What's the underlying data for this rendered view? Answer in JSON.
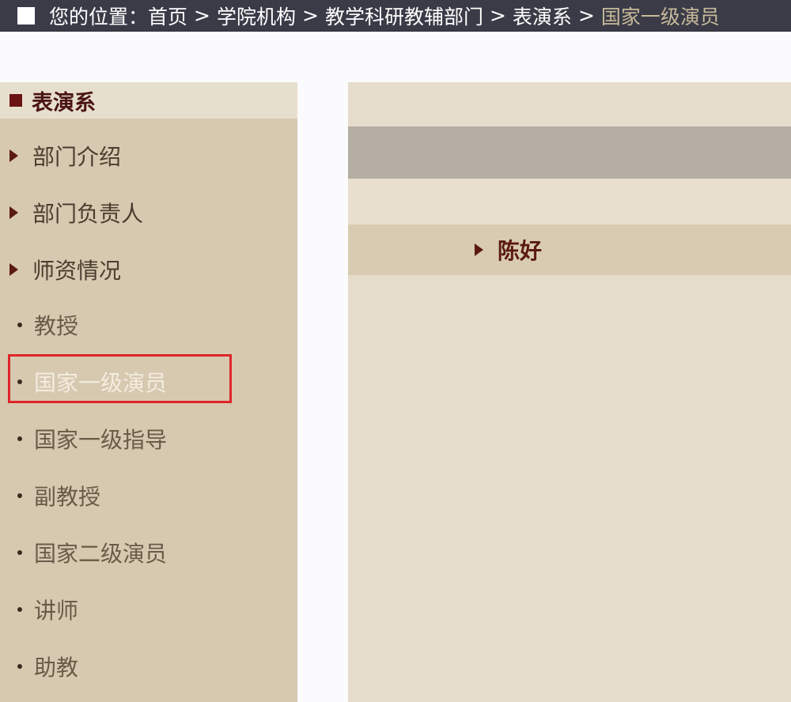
{
  "breadcrumb": {
    "prefix": "您的位置：",
    "items": [
      "首页",
      "学院机构",
      "教学科研教辅部门",
      "表演系"
    ],
    "current": "国家一级演员",
    "separator": ">"
  },
  "sidebar": {
    "title": "表演系",
    "sections": [
      {
        "label": "部门介绍"
      },
      {
        "label": "部门负责人"
      },
      {
        "label": "师资情况"
      }
    ],
    "subitems": [
      {
        "label": "教授"
      },
      {
        "label": "国家一级演员",
        "active": true
      },
      {
        "label": "国家一级指导"
      },
      {
        "label": "副教授"
      },
      {
        "label": "国家二级演员"
      },
      {
        "label": "讲师"
      },
      {
        "label": "助教"
      }
    ]
  },
  "main": {
    "people": [
      {
        "name": "陈好"
      }
    ]
  },
  "colors": {
    "breadcrumb_bg": "#3a3b47",
    "sidebar_bg": "#d6c9b0",
    "accent": "#6b1212",
    "highlight_border": "#e0252b"
  }
}
